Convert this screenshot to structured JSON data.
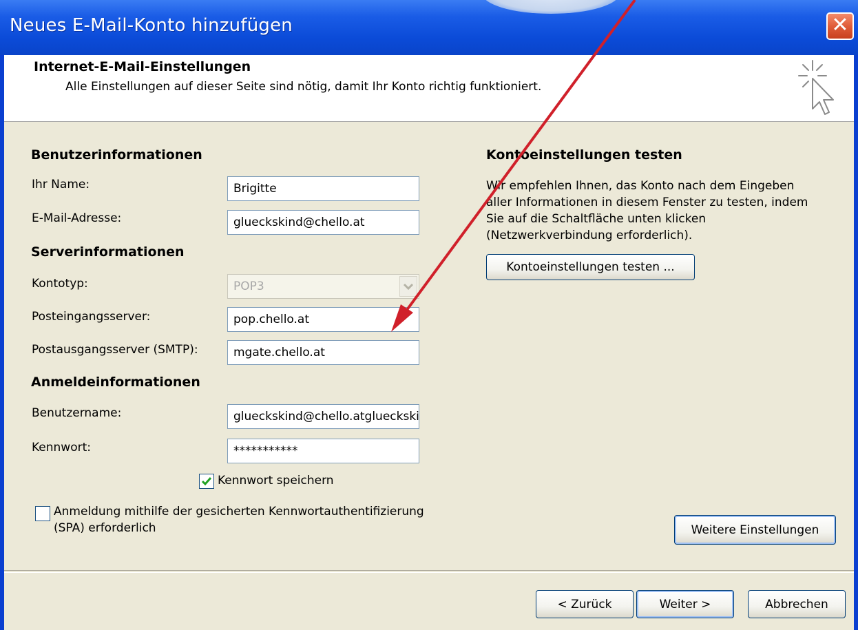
{
  "window": {
    "title": "Neues E-Mail-Konto hinzufügen",
    "close_label": "✕"
  },
  "header": {
    "title": "Internet-E-Mail-Einstellungen",
    "subtitle": "Alle Einstellungen auf dieser Seite sind nötig, damit Ihr Konto richtig funktioniert."
  },
  "user_info": {
    "title": "Benutzerinformationen",
    "name_label": "Ihr Name:",
    "name_value": "Brigitte",
    "email_label": "E-Mail-Adresse:",
    "email_value": "glueckskind@chello.at"
  },
  "server_info": {
    "title": "Serverinformationen",
    "account_type_label": "Kontotyp:",
    "account_type_value": "POP3",
    "incoming_label": "Posteingangsserver:",
    "incoming_value": "pop.chello.at",
    "outgoing_label": "Postausgangsserver (SMTP):",
    "outgoing_value": "mgate.chello.at"
  },
  "login_info": {
    "title": "Anmeldeinformationen",
    "username_label": "Benutzername:",
    "username_value": "glueckskind@chello.atglueckskind",
    "password_label": "Kennwort:",
    "password_value": "***********",
    "save_password_label": "Kennwort speichern",
    "save_password_checked": true,
    "spa_label_line1": "Anmeldung mithilfe der gesicherten Kennwortauthentifizierung",
    "spa_label_line2": "(SPA) erforderlich",
    "spa_checked": false
  },
  "test_settings": {
    "title": "Kontoeinstellungen testen",
    "line1": "Wir empfehlen Ihnen, das Konto nach dem Eingeben",
    "line2": "aller Informationen in diesem Fenster zu testen, indem",
    "line3": "Sie auf die Schaltfläche unten klicken",
    "line4": "(Netzwerkverbindung erforderlich).",
    "test_button": "Kontoeinstellungen testen ..."
  },
  "buttons": {
    "more_settings": "Weitere Einstellungen",
    "back": "< Zurück",
    "next": "Weiter >",
    "cancel": "Abbrechen"
  },
  "colors": {
    "titlebar": "#0b4bd8",
    "client_bg": "#ece9d8",
    "annotation_arrow": "#d0202a",
    "check_green": "#21a121"
  },
  "icons": {
    "wizard": "cursor-sparkle-icon",
    "checkmark": "checkmark-icon",
    "dropdown": "chevron-down-icon"
  }
}
